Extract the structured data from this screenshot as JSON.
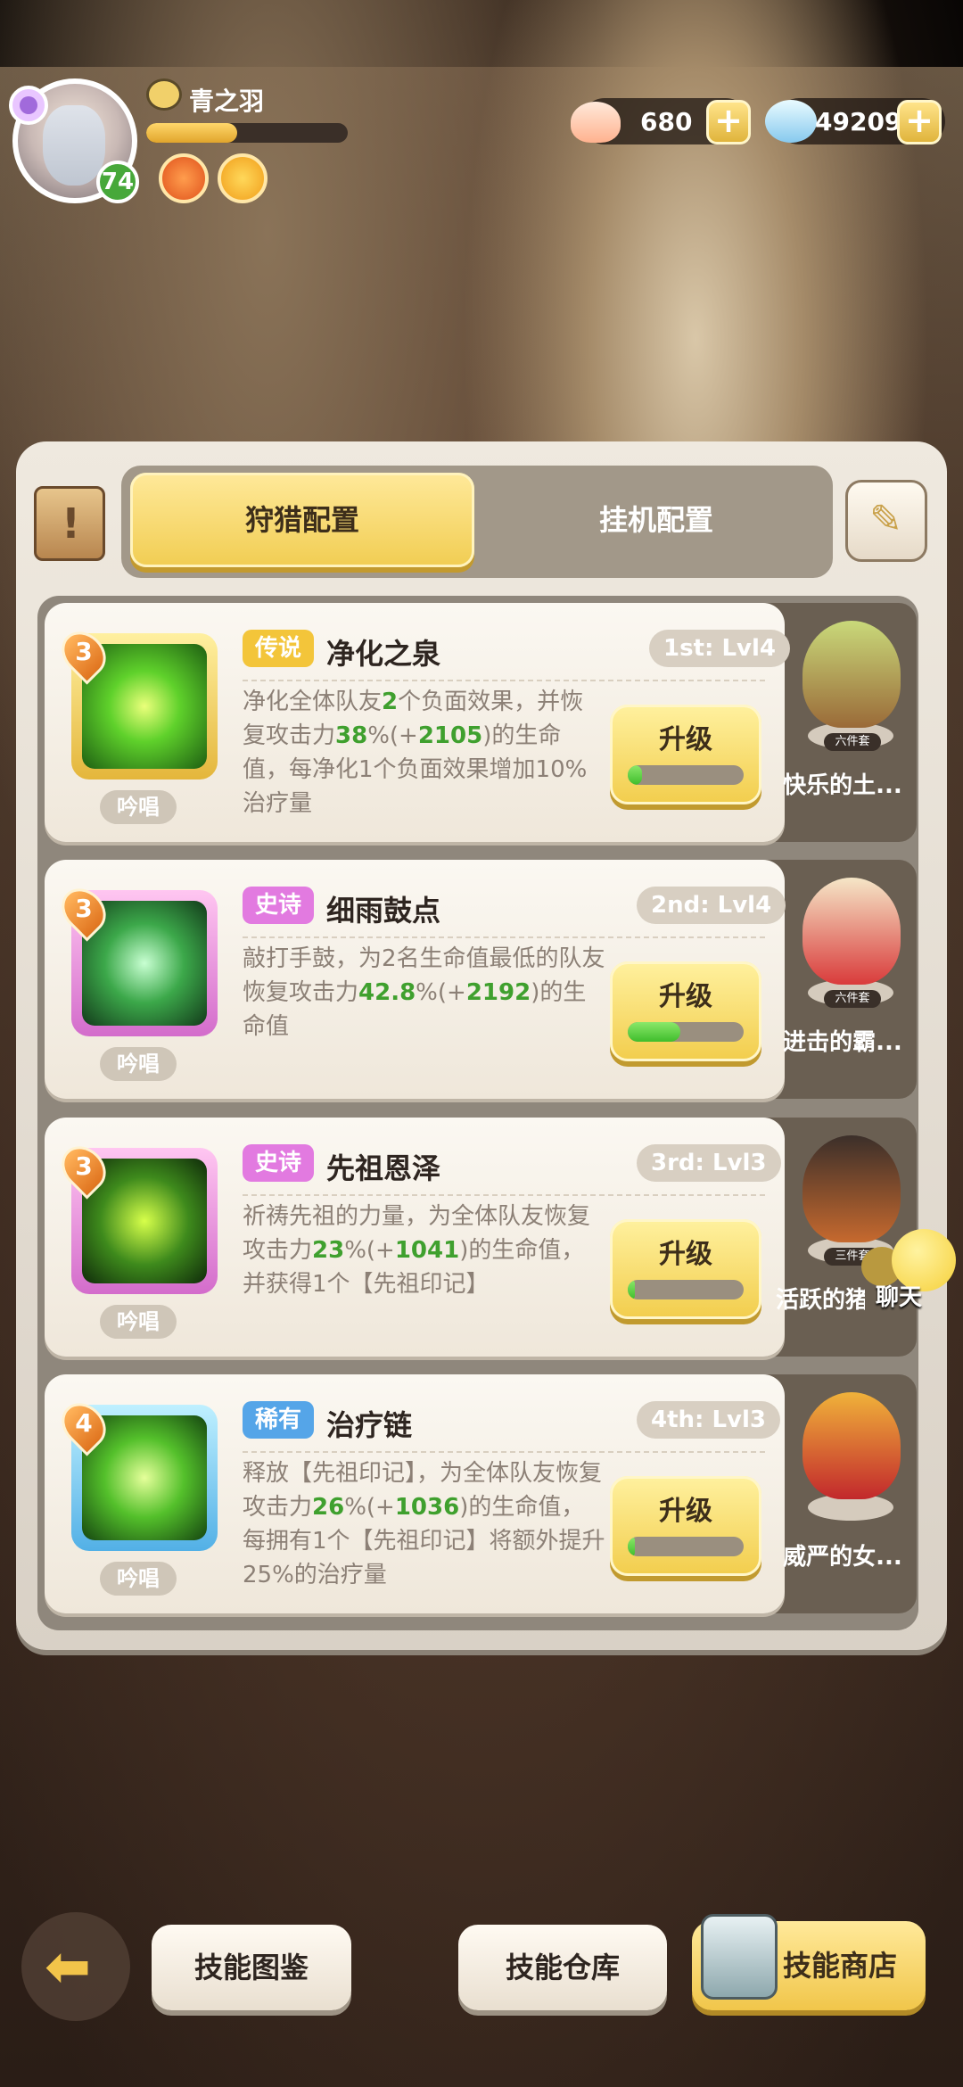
{
  "player": {
    "name": "青之羽",
    "level": "74",
    "exp_fraction": 0.45
  },
  "resources": {
    "shells": "680",
    "gems": "492094"
  },
  "tabs": [
    {
      "label": "狩猎配置",
      "active": true
    },
    {
      "label": "挂机配置",
      "active": false
    }
  ],
  "skills": [
    {
      "level": "3",
      "rarity": "传说",
      "name": "净化之泉",
      "slot": "1st: Lvl4",
      "desc_parts": [
        "净化全体队友",
        "2",
        "个负面效果，并恢复攻击力",
        "38",
        "%(+",
        "2105",
        ")的生命值，每净化1个负面效果增加10%治疗量"
      ],
      "chant": "吟唱",
      "upgrade": "升级",
      "progress": 0.12,
      "pet_name": "快乐的土...",
      "pet_set": "六件套"
    },
    {
      "level": "3",
      "rarity": "史诗",
      "name": "细雨鼓点",
      "slot": "2nd: Lvl4",
      "desc_parts": [
        "敲打手鼓，为2名生命值最低的队友恢复攻击力",
        "42.8",
        "%(+",
        "2192",
        ")的生命值"
      ],
      "chant": "吟唱",
      "upgrade": "升级",
      "progress": 0.45,
      "pet_name": "进击的霸...",
      "pet_set": "六件套"
    },
    {
      "level": "3",
      "rarity": "史诗",
      "name": "先祖恩泽",
      "slot": "3rd: Lvl3",
      "desc_parts": [
        "祈祷先祖的力量，为全体队友恢复攻击力",
        "23",
        "%(+",
        "1041",
        ")的生命值，并获得1个【先祖印记】"
      ],
      "chant": "吟唱",
      "upgrade": "升级",
      "progress": 0.03,
      "pet_name": "活跃的猪",
      "pet_set": "三件套"
    },
    {
      "level": "4",
      "rarity": "稀有",
      "name": "治疗链",
      "slot": "4th: Lvl3",
      "desc_parts": [
        "释放【先祖印记】，为全体队友恢复攻击力",
        "26",
        "%(+",
        "1036",
        ")的生命值，每拥有1个【先祖印记】将额外提升25%的治疗量"
      ],
      "chant": "吟唱",
      "upgrade": "升级",
      "progress": 0.03,
      "pet_name": "威严的女...",
      "pet_set": ""
    }
  ],
  "chat": {
    "label": "聊天"
  },
  "bottom": {
    "codex": "技能图鉴",
    "storage": "技能仓库",
    "shop": "技能商店"
  },
  "colors": {
    "accent": "#f2cd4c",
    "legend": "#f3c53a",
    "epic": "#e27ae0",
    "rare": "#55a5e8",
    "highlight": "#3fa02e"
  }
}
